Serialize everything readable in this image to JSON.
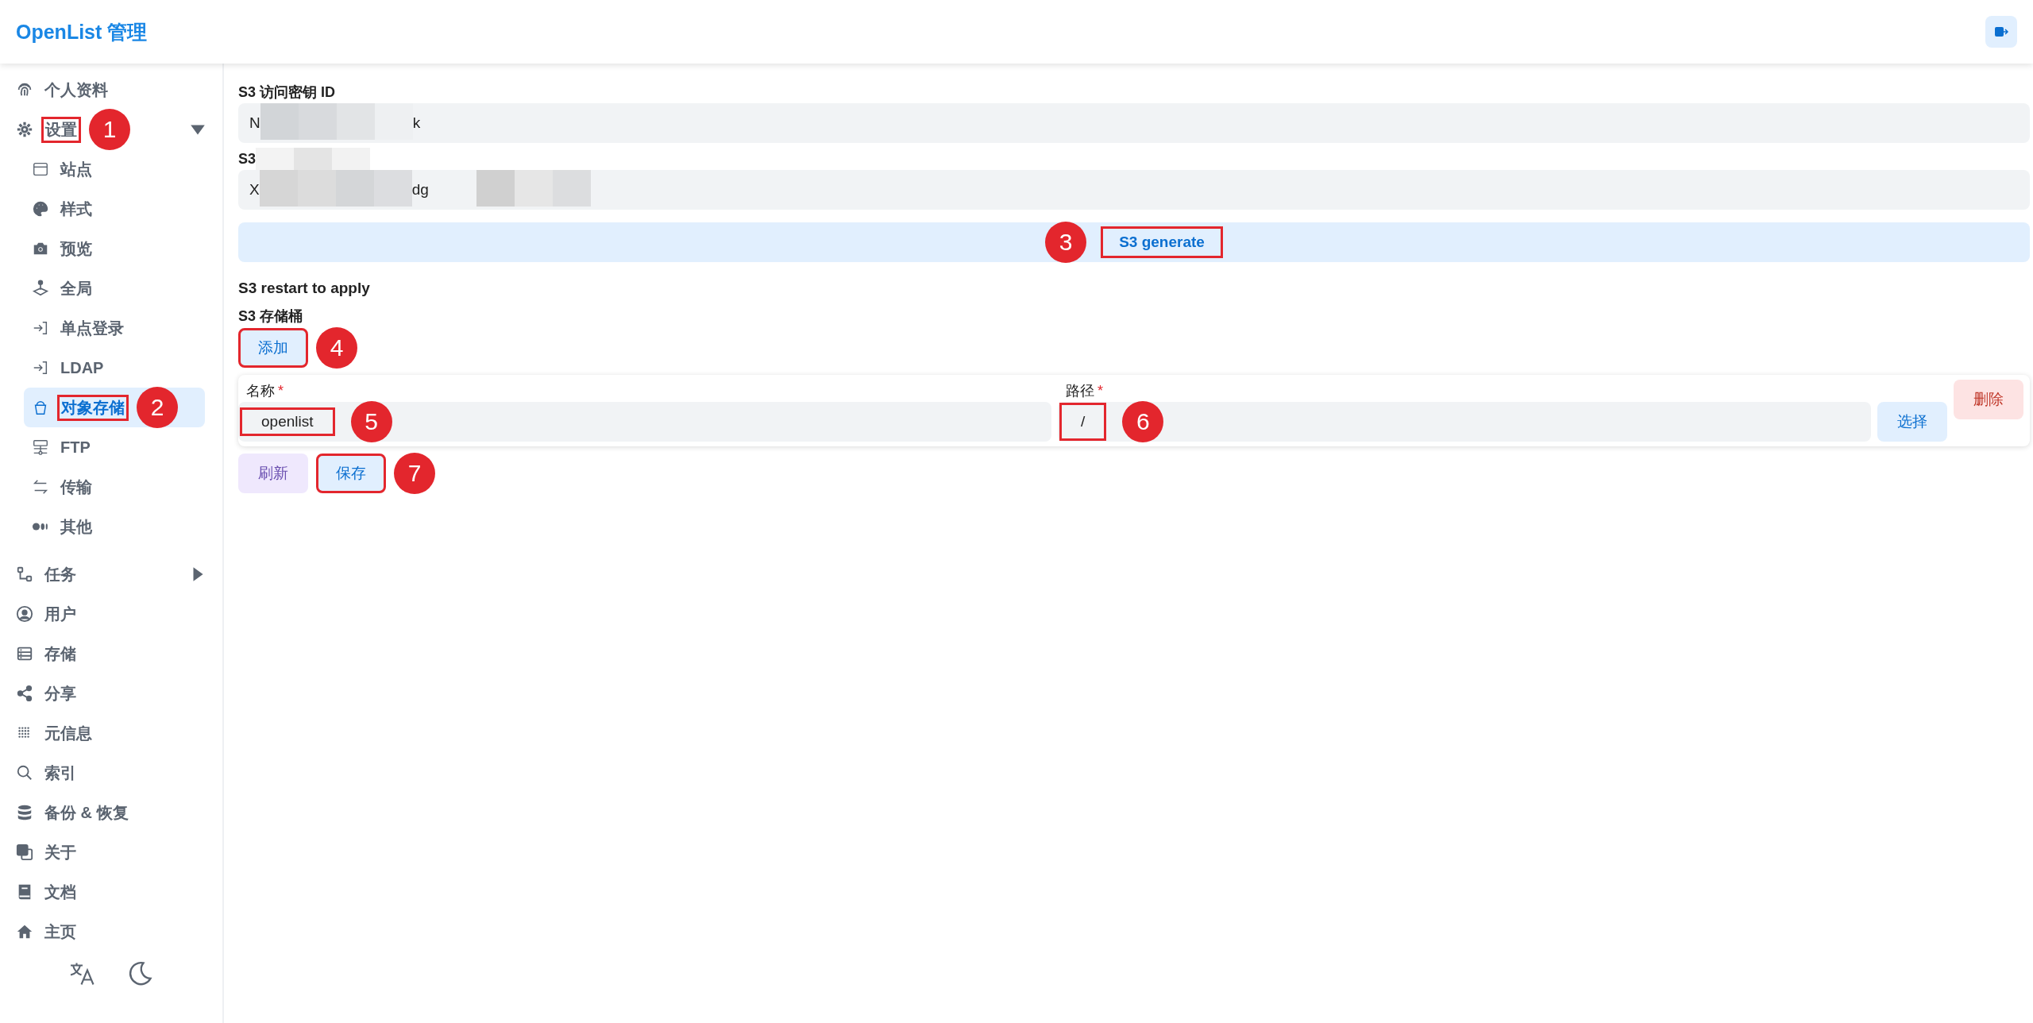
{
  "header": {
    "title": "OpenList 管理"
  },
  "sidebar": {
    "items": [
      {
        "label": "个人资料",
        "selected": false
      },
      {
        "label": "设置",
        "selected": false,
        "expanded": true,
        "highlighted": true,
        "callout": "1",
        "children": [
          {
            "label": "站点",
            "selected": false
          },
          {
            "label": "样式",
            "selected": false
          },
          {
            "label": "预览",
            "selected": false
          },
          {
            "label": "全局",
            "selected": false
          },
          {
            "label": "单点登录",
            "selected": false
          },
          {
            "label": "LDAP",
            "selected": false
          },
          {
            "label": "对象存储",
            "selected": true,
            "highlighted": true,
            "callout": "2"
          },
          {
            "label": "FTP",
            "selected": false
          },
          {
            "label": "传输",
            "selected": false
          },
          {
            "label": "其他",
            "selected": false
          }
        ]
      },
      {
        "label": "任务",
        "selected": false,
        "expanded": false
      },
      {
        "label": "用户",
        "selected": false
      },
      {
        "label": "存储",
        "selected": false
      },
      {
        "label": "分享",
        "selected": false
      },
      {
        "label": "元信息",
        "selected": false
      },
      {
        "label": "索引",
        "selected": false
      },
      {
        "label": "备份 & 恢复",
        "selected": false
      },
      {
        "label": "关于",
        "selected": false
      },
      {
        "label": "文档",
        "selected": false
      },
      {
        "label": "主页",
        "selected": false
      }
    ]
  },
  "form": {
    "access_key": {
      "label": "S3 访问密钥 ID",
      "value_start": "N",
      "value_end": "k"
    },
    "secret_key": {
      "label": "S3",
      "value_start": "X",
      "value_end": "dg"
    },
    "generate_button": {
      "label": "S3 generate",
      "highlighted": true,
      "callout": "3"
    },
    "restart_note": "S3 restart to apply",
    "buckets_label": "S3 存储桶",
    "add_button": {
      "label": "添加",
      "highlighted": true,
      "callout": "4"
    },
    "buckets": [
      {
        "name_label": "名称",
        "name_required": "*",
        "name": "openlist",
        "name_highlighted": true,
        "name_callout": "5",
        "path_label": "路径",
        "path_required": "*",
        "path": "/",
        "path_highlighted": true,
        "path_callout": "6",
        "select_button": "选择",
        "delete_button": "删除"
      }
    ],
    "refresh_button": {
      "label": "刷新"
    },
    "save_button": {
      "label": "保存",
      "highlighted": true,
      "callout": "7"
    }
  }
}
